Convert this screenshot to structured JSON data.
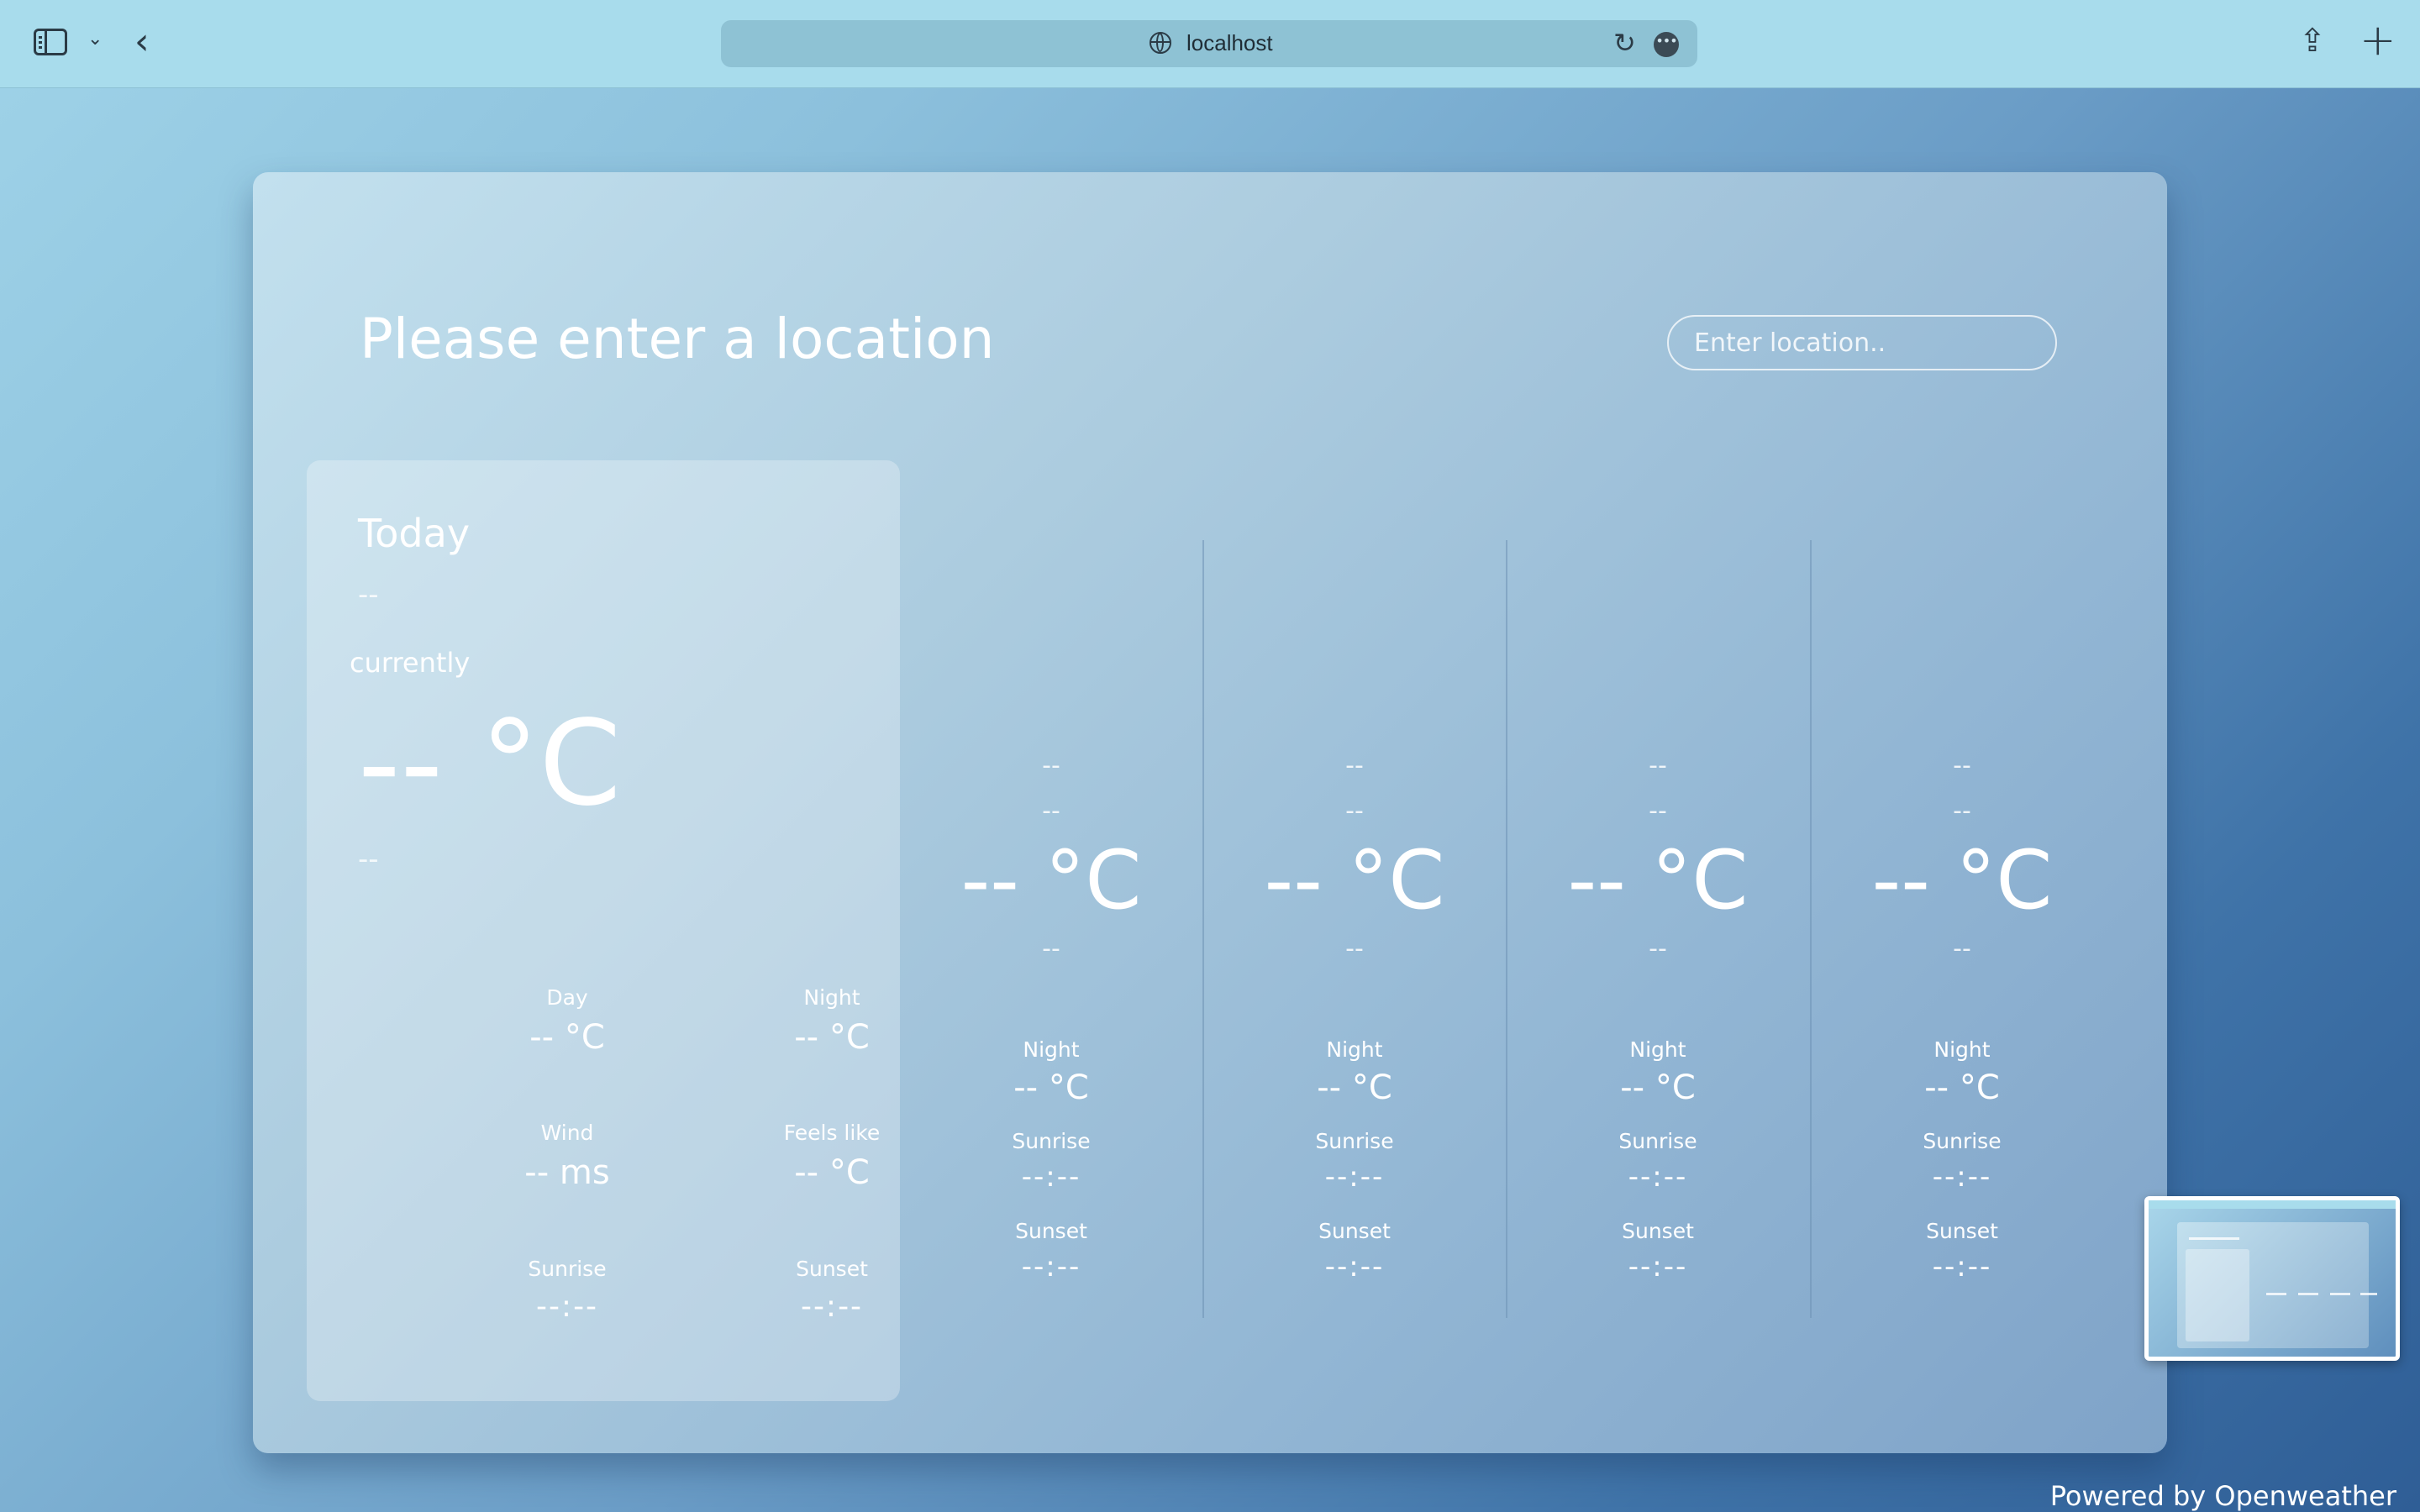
{
  "browser": {
    "url": "localhost",
    "icons": [
      "sidebar-icon",
      "chevron-down-icon",
      "back-icon",
      "globe-icon",
      "reload-icon",
      "more-icon",
      "share-icon",
      "plus-icon"
    ]
  },
  "header": {
    "title": "Please enter a location",
    "search_placeholder": "Enter location.."
  },
  "today": {
    "label": "Today",
    "date": "--",
    "currently": "currently",
    "temp": "-- °C",
    "description": "--",
    "stats": [
      {
        "label": "Day",
        "value": "-- °C"
      },
      {
        "label": "Night",
        "value": "-- °C"
      },
      {
        "label": "Wind",
        "value": "-- ms"
      },
      {
        "label": "Feels like",
        "value": "-- °C"
      },
      {
        "label": "Sunrise",
        "value": "--:--"
      },
      {
        "label": "Sunset",
        "value": "--:--"
      }
    ]
  },
  "forecast": [
    {
      "day": "--",
      "date": "--",
      "temp": "-- °C",
      "desc": "--",
      "night_label": "Night",
      "night": "-- °C",
      "sunrise_label": "Sunrise",
      "sunrise": "--:--",
      "sunset_label": "Sunset",
      "sunset": "--:--"
    },
    {
      "day": "--",
      "date": "--",
      "temp": "-- °C",
      "desc": "--",
      "night_label": "Night",
      "night": "-- °C",
      "sunrise_label": "Sunrise",
      "sunrise": "--:--",
      "sunset_label": "Sunset",
      "sunset": "--:--"
    },
    {
      "day": "--",
      "date": "--",
      "temp": "-- °C",
      "desc": "--",
      "night_label": "Night",
      "night": "-- °C",
      "sunrise_label": "Sunrise",
      "sunrise": "--:--",
      "sunset_label": "Sunset",
      "sunset": "--:--"
    },
    {
      "day": "--",
      "date": "--",
      "temp": "-- °C",
      "desc": "--",
      "night_label": "Night",
      "night": "-- °C",
      "sunrise_label": "Sunrise",
      "sunrise": "--:--",
      "sunset_label": "Sunset",
      "sunset": "--:--"
    }
  ],
  "footer": {
    "powered_by": "Powered by Openweather"
  }
}
